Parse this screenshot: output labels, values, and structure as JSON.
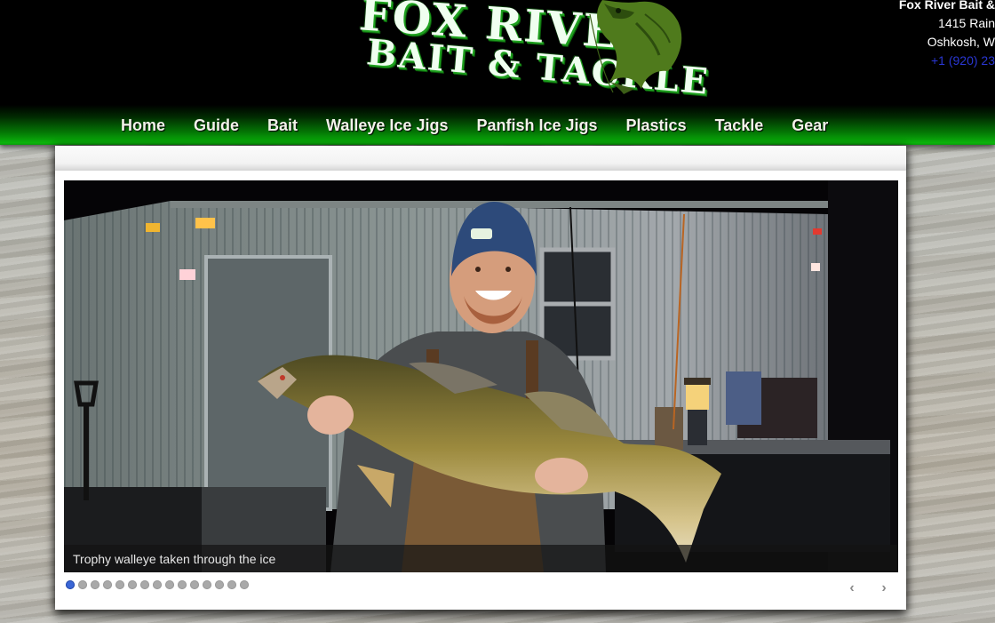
{
  "header": {
    "logo": {
      "line1": "FOX RIVER",
      "line2": "BAIT & TACKLE",
      "alt": "Fox River Bait & Tackle logo"
    },
    "contact": {
      "name": "Fox River Bait &",
      "street": "1415 Rain",
      "city": "Oshkosh, W",
      "phone": "+1 (920) 23"
    }
  },
  "nav": {
    "items": [
      {
        "label": "Home"
      },
      {
        "label": "Guide"
      },
      {
        "label": "Bait"
      },
      {
        "label": "Walleye Ice Jigs"
      },
      {
        "label": "Panfish Ice Jigs"
      },
      {
        "label": "Plastics"
      },
      {
        "label": "Tackle"
      },
      {
        "label": "Gear"
      }
    ]
  },
  "slideshow": {
    "caption": "Trophy walleye taken through the ice",
    "current_slide": 1,
    "total_slides": 15,
    "prev_icon": "chevron-left-icon",
    "next_icon": "chevron-right-icon",
    "prev_glyph": "‹",
    "next_glyph": "›"
  },
  "colors": {
    "header_bg": "#000000",
    "nav_green": "#0bb30b",
    "logo_green": "#1fa11f",
    "phone_link": "#2a37d4",
    "active_dot": "#3a66d6",
    "inactive_dot": "#a9a9a9"
  }
}
